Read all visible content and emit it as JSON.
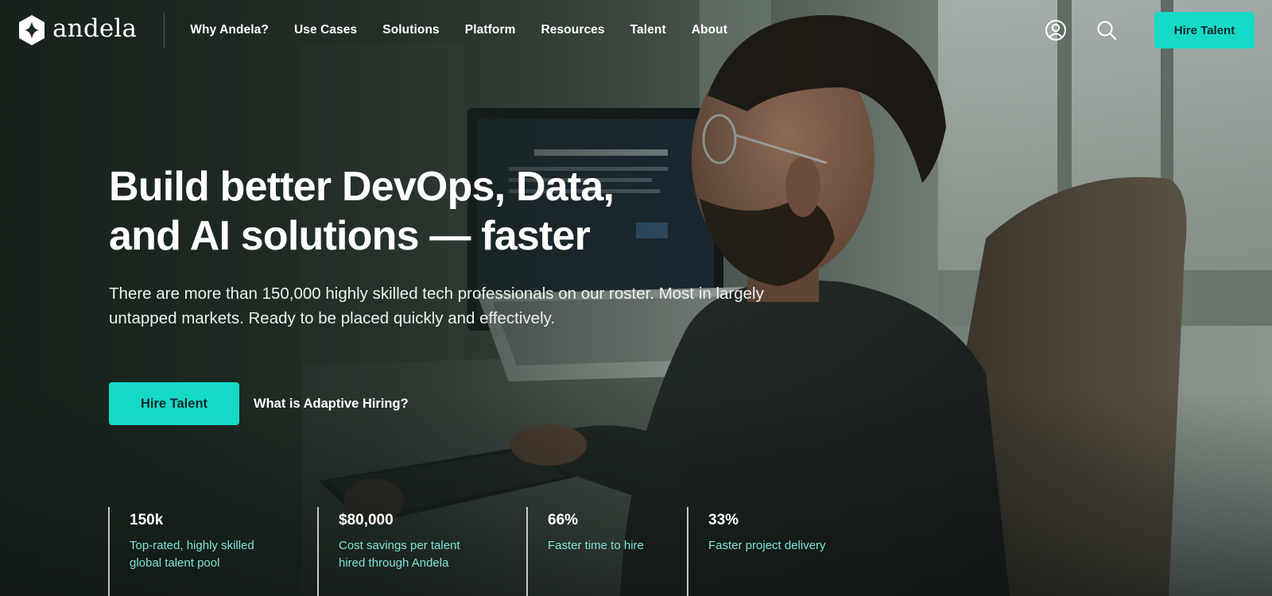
{
  "brand": {
    "name": "andela",
    "logo_icon": "andela-diamond-star-icon",
    "accent_color": "#16d9c6"
  },
  "nav": {
    "items": [
      {
        "label": "Why Andela?"
      },
      {
        "label": "Use Cases"
      },
      {
        "label": "Solutions"
      },
      {
        "label": "Platform"
      },
      {
        "label": "Resources"
      },
      {
        "label": "Talent"
      },
      {
        "label": "About"
      }
    ],
    "account_icon": "user-circle-icon",
    "search_icon": "search-icon",
    "hire_label": "Hire Talent"
  },
  "hero": {
    "title_line1": "Build better DevOps, Data,",
    "title_line2": "and AI solutions — faster",
    "subtitle": "There are more than 150,000 highly skilled tech professionals on our roster. Most in largely untapped markets. Ready to be placed quickly and effectively.",
    "primary_cta": "Hire Talent",
    "secondary_cta": "What is Adaptive Hiring?"
  },
  "stats": [
    {
      "value": "150k",
      "line1": "Top-rated, highly skilled",
      "line2": "global talent pool"
    },
    {
      "value": "$80,000",
      "line1": "Cost savings per talent",
      "line2": "hired through Andela"
    },
    {
      "value": "66%",
      "line1": "Faster time to hire",
      "line2": ""
    },
    {
      "value": "33%",
      "line1": "Faster project delivery",
      "line2": ""
    }
  ]
}
